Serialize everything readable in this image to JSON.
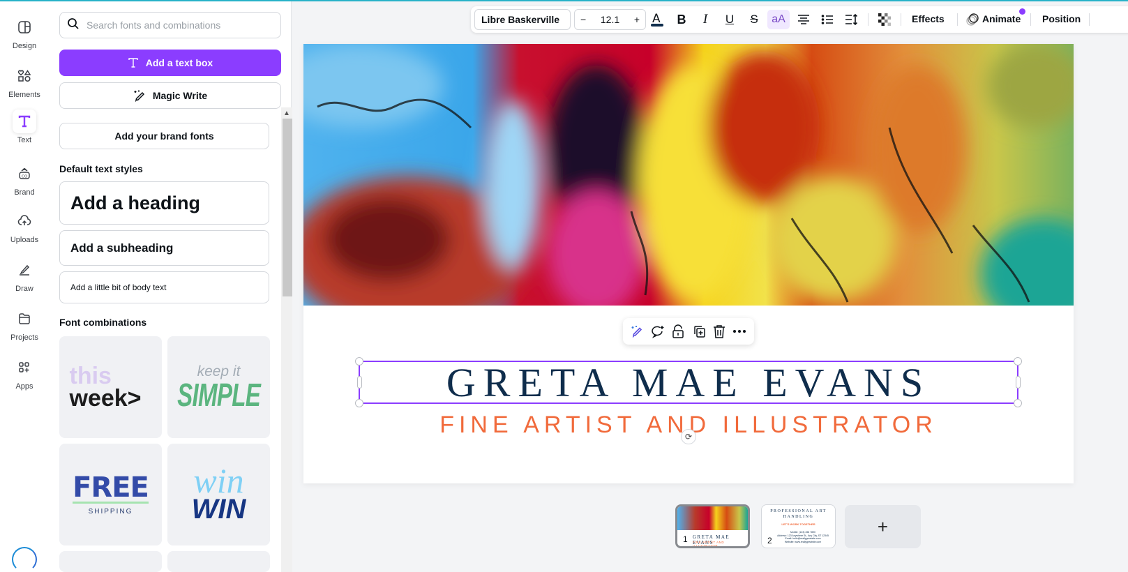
{
  "rail": {
    "items": [
      {
        "label": "Design",
        "icon": "layout-icon"
      },
      {
        "label": "Elements",
        "icon": "shapes-icon"
      },
      {
        "label": "Text",
        "icon": "text-T-icon",
        "active": true
      },
      {
        "label": "Brand",
        "icon": "brand-kit-icon"
      },
      {
        "label": "Uploads",
        "icon": "cloud-upload-icon"
      },
      {
        "label": "Draw",
        "icon": "pen-icon"
      },
      {
        "label": "Projects",
        "icon": "folder-icon"
      },
      {
        "label": "Apps",
        "icon": "apps-grid-icon"
      }
    ]
  },
  "panel": {
    "search_placeholder": "Search fonts and combinations",
    "add_textbox_label": "Add a text box",
    "magic_write_label": "Magic Write",
    "brand_fonts_label": "Add your brand fonts",
    "default_styles_title": "Default text styles",
    "heading_label": "Add a heading",
    "subheading_label": "Add a subheading",
    "body_label": "Add a little bit of body text",
    "combinations_title": "Font combinations",
    "combinations": [
      {
        "line1": "this",
        "line2": "week>"
      },
      {
        "line1": "keep it",
        "line2": "SIMPLE"
      },
      {
        "line1": "FREE",
        "line2": "SHIPPING"
      },
      {
        "line1": "win",
        "line2": "WIN"
      }
    ]
  },
  "toolbar": {
    "font": "Libre Baskerville",
    "decrease": "−",
    "size": "12.1",
    "increase": "+",
    "effects_label": "Effects",
    "animate_label": "Animate",
    "position_label": "Position",
    "accent_color": "#8b3dff",
    "text_color": "#0f2d4c"
  },
  "canvas": {
    "title": "GRETA MAE EVANS",
    "subtitle": "FINE ARTIST AND ILLUSTRATOR",
    "title_color": "#0f2d4c",
    "subtitle_color": "#f16a3b"
  },
  "pages": [
    {
      "number": "1",
      "title": "GRETA MAE EVANS",
      "subtitle": "FINE ARTIST AND ILLUSTRATOR"
    },
    {
      "number": "2",
      "title": "PROFESSIONAL ART HANDLING",
      "subtitle": "LET'S WORK TOGETHER",
      "lines": [
        "Mobile: (123) 456 7890",
        "Address: 123 Anywhere St., Any City, ST 12345",
        "Email: hello@reallygreatsite.com",
        "Website: www.reallygreatsite.com"
      ]
    }
  ],
  "add_page_label": "+"
}
